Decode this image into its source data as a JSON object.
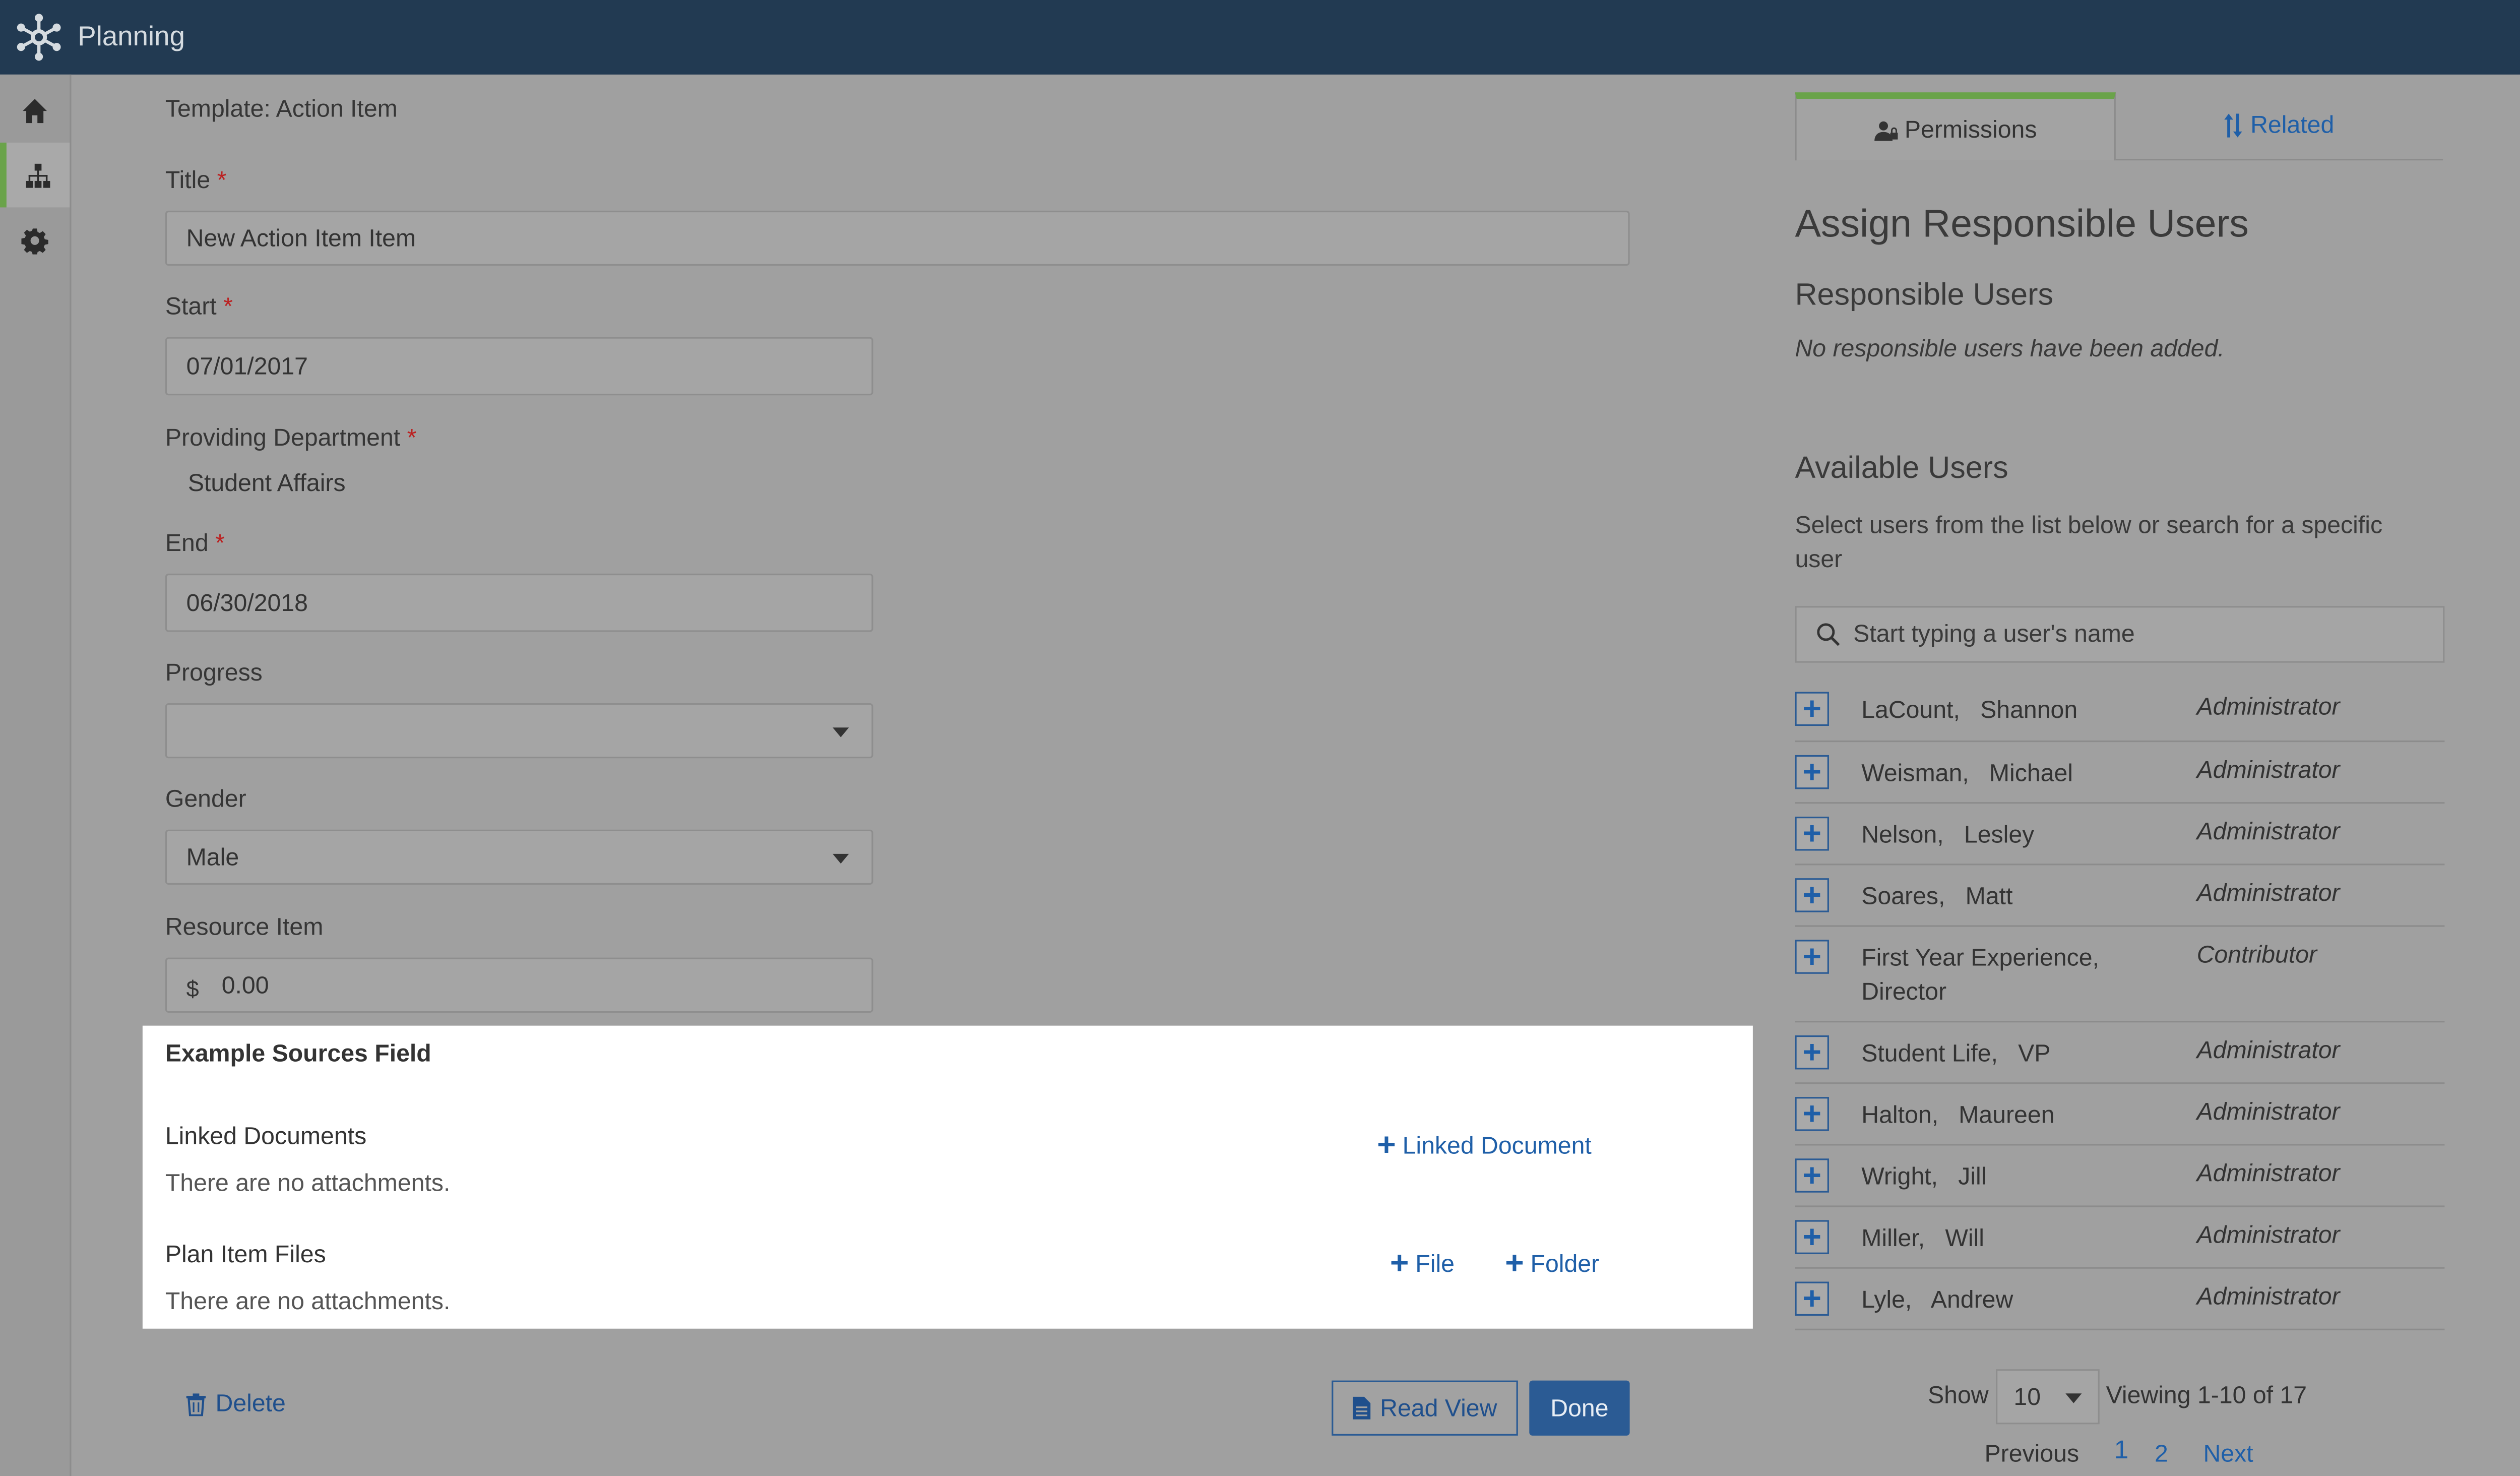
{
  "app": {
    "title": "Planning",
    "logo_icon": "network-logo-icon"
  },
  "sidenav": {
    "items": [
      {
        "icon": "home-icon",
        "active": false
      },
      {
        "icon": "sitemap-icon",
        "active": true
      },
      {
        "icon": "gear-icon",
        "active": false
      }
    ]
  },
  "form": {
    "template_label": "Template: Action Item",
    "title": {
      "label": "Title",
      "required": "*",
      "value": "New Action Item Item"
    },
    "start": {
      "label": "Start",
      "required": "*",
      "value": "07/01/2017"
    },
    "department": {
      "label": "Providing Department",
      "required": "*",
      "value": "Student Affairs"
    },
    "end": {
      "label": "End",
      "required": "*",
      "value": "06/30/2018"
    },
    "progress": {
      "label": "Progress",
      "value": ""
    },
    "gender": {
      "label": "Gender",
      "value": "Male"
    },
    "resource": {
      "label": "Resource Item",
      "prefix": "$",
      "value": "0.00"
    }
  },
  "sources": {
    "heading": "Example Sources Field",
    "linked_documents": {
      "label": "Linked Documents",
      "empty": "There are no attachments.",
      "add_label": "Linked Document"
    },
    "plan_item_files": {
      "label": "Plan Item Files",
      "empty": "There are no attachments.",
      "add_file_label": "File",
      "add_folder_label": "Folder"
    }
  },
  "actions": {
    "delete_label": "Delete",
    "read_view_label": "Read View",
    "done_label": "Done"
  },
  "tabs": {
    "permissions_label": "Permissions",
    "related_label": "Related"
  },
  "permissions": {
    "heading": "Assign Responsible Users",
    "responsible_heading": "Responsible Users",
    "responsible_empty": "No responsible users have been added.",
    "available_heading": "Available Users",
    "available_help": "Select users from the list below or search for a specific user",
    "search_placeholder": "Start typing a user's name",
    "users": [
      {
        "name": "LaCount,   Shannon",
        "role": "Administrator"
      },
      {
        "name": "Weisman,   Michael",
        "role": "Administrator"
      },
      {
        "name": "Nelson,   Lesley",
        "role": "Administrator"
      },
      {
        "name": "Soares,   Matt",
        "role": "Administrator"
      },
      {
        "name": "First Year Experience,   Director",
        "role": "Contributor"
      },
      {
        "name": "Student Life,   VP",
        "role": "Administrator"
      },
      {
        "name": "Halton,   Maureen",
        "role": "Administrator"
      },
      {
        "name": "Wright,   Jill",
        "role": "Administrator"
      },
      {
        "name": "Miller,   Will",
        "role": "Administrator"
      },
      {
        "name": "Lyle,   Andrew",
        "role": "Administrator"
      }
    ],
    "pager": {
      "show_label": "Show",
      "page_size": "10",
      "viewing": "Viewing 1-10 of 17",
      "previous": "Previous",
      "pages": [
        "1",
        "2"
      ],
      "next": "Next"
    }
  },
  "colors": {
    "topbar": "#223a52",
    "accent_green": "#6aa34a",
    "link_blue": "#1f5fa8",
    "primary_button": "#2b5b94"
  }
}
